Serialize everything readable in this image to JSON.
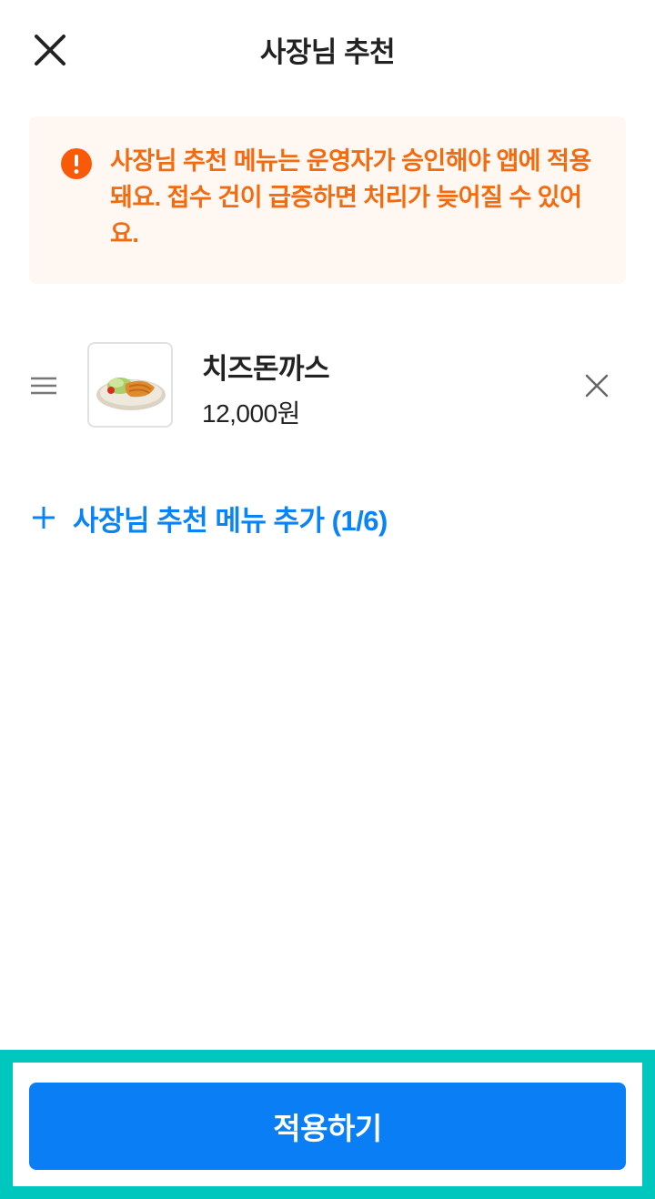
{
  "header": {
    "title": "사장님 추천",
    "close_icon": "close-icon"
  },
  "notice": {
    "icon": "alert-circle-icon",
    "text": "사장님 추천 메뉴는 운영자가 승인해야 앱에 적용돼요. 접수 건이 급증하면 처리가 늦어질 수 있어요.",
    "color": "#f36b10",
    "background": "#fff7f1"
  },
  "menu_items": [
    {
      "name": "치즈돈까스",
      "price": "12,000원",
      "thumbnail": "food-thumbnail",
      "drag_icon": "drag-handle-icon",
      "remove_icon": "close-icon"
    }
  ],
  "add_menu": {
    "label": "사장님 추천 메뉴 추가 (1/6)",
    "icon": "plus-icon",
    "color": "#0a84f5"
  },
  "footer": {
    "apply_label": "적용하기",
    "button_color": "#0a7ff5",
    "highlight_color": "#00c7be"
  }
}
